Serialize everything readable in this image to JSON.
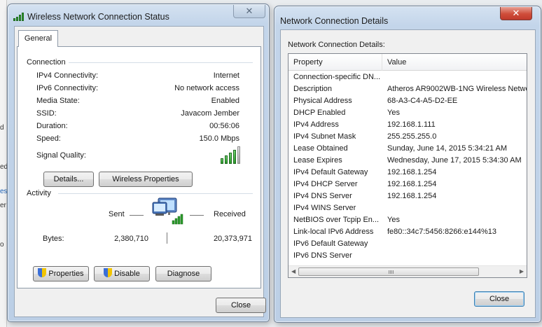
{
  "background": {
    "fragments": [
      "d",
      "ed",
      "es",
      "er",
      "o"
    ]
  },
  "status_window": {
    "title": "Wireless Network Connection Status",
    "close_glyph": "✕",
    "tab": "General",
    "connection": {
      "group_label": "Connection",
      "rows": [
        {
          "label": "IPv4 Connectivity:",
          "value": "Internet"
        },
        {
          "label": "IPv6 Connectivity:",
          "value": "No network access"
        },
        {
          "label": "Media State:",
          "value": "Enabled"
        },
        {
          "label": "SSID:",
          "value": "Javacom Jember"
        },
        {
          "label": "Duration:",
          "value": "00:56:06"
        },
        {
          "label": "Speed:",
          "value": "150.0 Mbps"
        }
      ],
      "signal_label": "Signal Quality:",
      "signal_bars_lit": 4,
      "signal_bars_total": 5
    },
    "details_button": "Details...",
    "wireless_properties_button": "Wireless Properties",
    "activity": {
      "group_label": "Activity",
      "sent_label": "Sent",
      "received_label": "Received",
      "bytes_label": "Bytes:",
      "bytes_sent": "2,380,710",
      "bytes_received": "20,373,971"
    },
    "properties_button": "Properties",
    "disable_button": "Disable",
    "diagnose_button": "Diagnose",
    "close_button": "Close"
  },
  "details_window": {
    "title": "Network Connection Details",
    "close_glyph": "✕",
    "list_label": "Network Connection Details:",
    "columns": {
      "property": "Property",
      "value": "Value"
    },
    "rows": [
      {
        "property": "Connection-specific DN...",
        "value": ""
      },
      {
        "property": "Description",
        "value": "Atheros AR9002WB-1NG Wireless Netwo"
      },
      {
        "property": "Physical Address",
        "value": "68-A3-C4-A5-D2-EE"
      },
      {
        "property": "DHCP Enabled",
        "value": "Yes"
      },
      {
        "property": "IPv4 Address",
        "value": "192.168.1.111"
      },
      {
        "property": "IPv4 Subnet Mask",
        "value": "255.255.255.0"
      },
      {
        "property": "Lease Obtained",
        "value": "Sunday, June 14, 2015 5:34:21 AM"
      },
      {
        "property": "Lease Expires",
        "value": "Wednesday, June 17, 2015 5:34:30 AM"
      },
      {
        "property": "IPv4 Default Gateway",
        "value": "192.168.1.254"
      },
      {
        "property": "IPv4 DHCP Server",
        "value": "192.168.1.254"
      },
      {
        "property": "IPv4 DNS Server",
        "value": "192.168.1.254"
      },
      {
        "property": "IPv4 WINS Server",
        "value": ""
      },
      {
        "property": "NetBIOS over Tcpip En...",
        "value": "Yes"
      },
      {
        "property": "Link-local IPv6 Address",
        "value": "fe80::34c7:5456:8266:e144%13"
      },
      {
        "property": "IPv6 Default Gateway",
        "value": ""
      },
      {
        "property": "IPv6 DNS Server",
        "value": ""
      }
    ],
    "close_button": "Close"
  },
  "colors": {
    "signal_green": "#2b9a2b",
    "close_red": "#c0392b",
    "frame_blue": "#bccfe6"
  }
}
